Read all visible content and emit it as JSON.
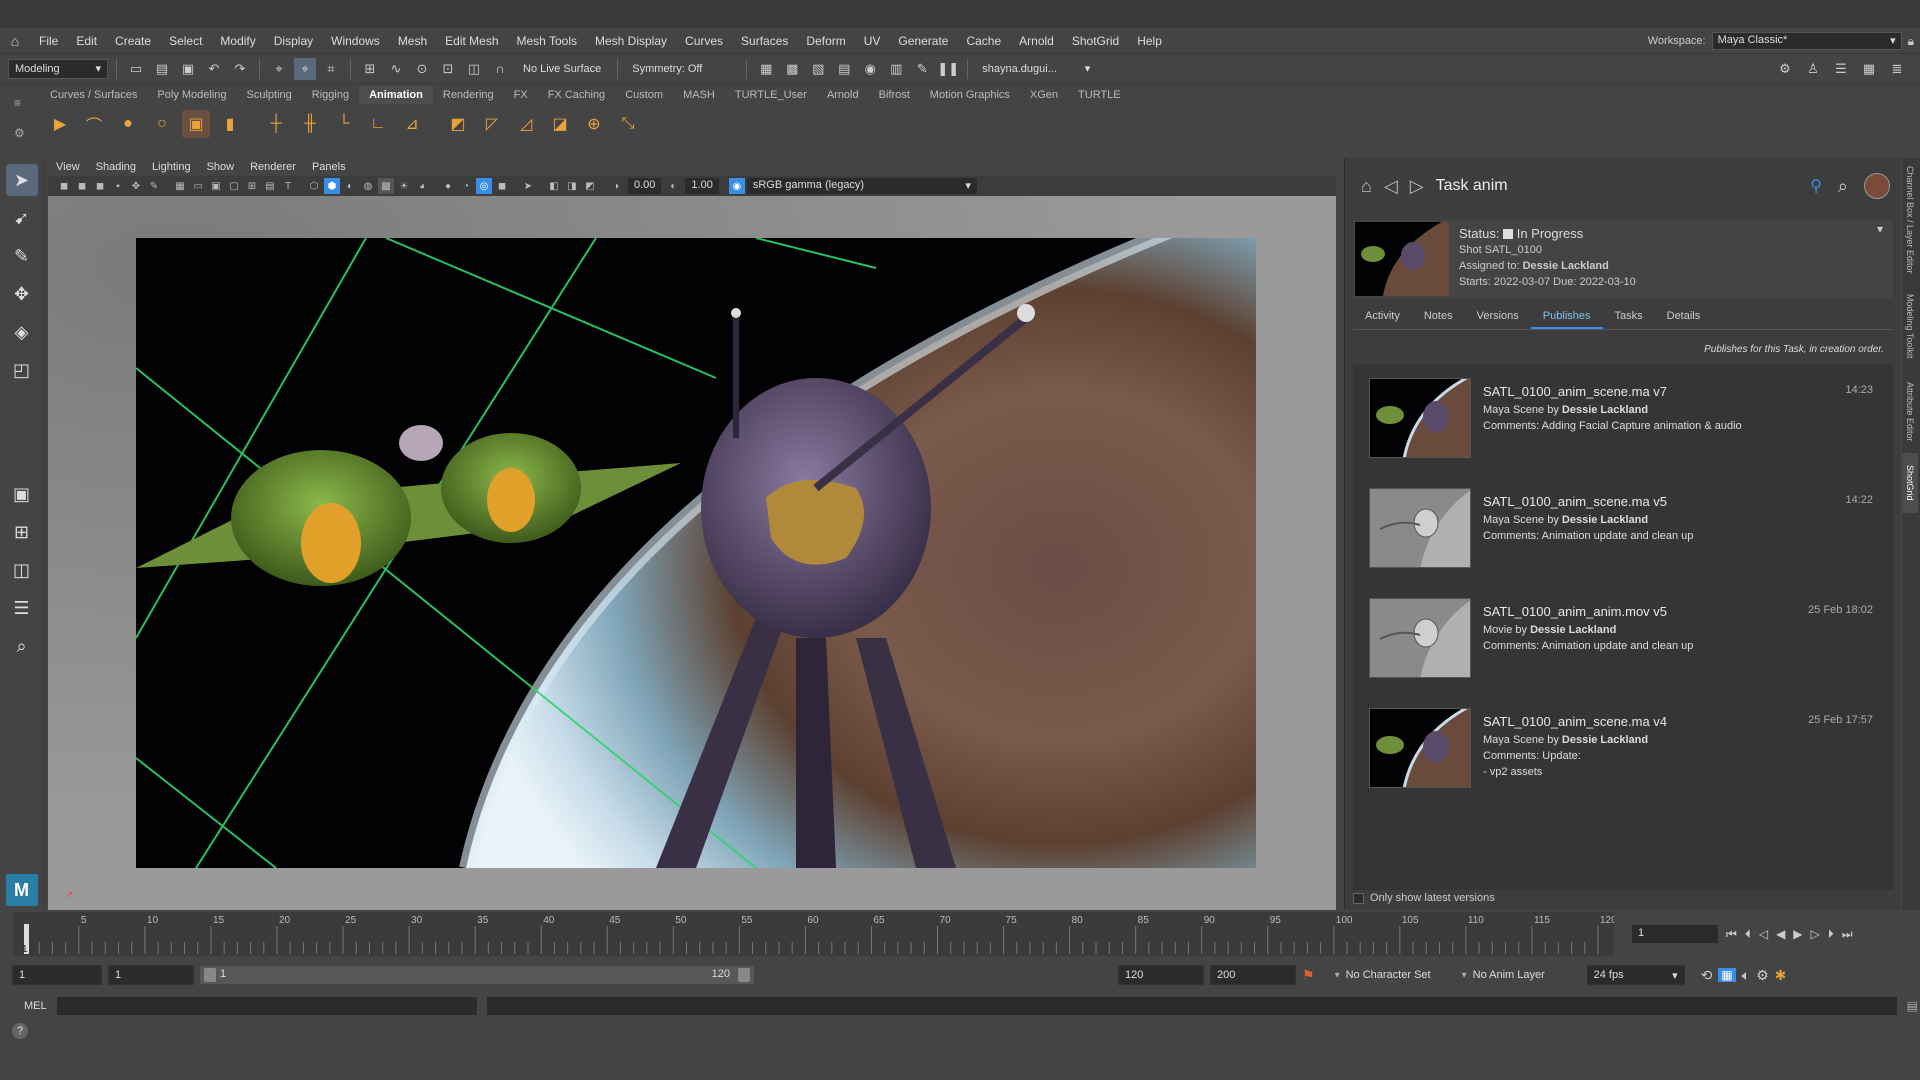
{
  "menubar": {
    "items": [
      "File",
      "Edit",
      "Create",
      "Select",
      "Modify",
      "Display",
      "Windows",
      "Mesh",
      "Edit Mesh",
      "Mesh Tools",
      "Mesh Display",
      "Curves",
      "Surfaces",
      "Deform",
      "UV",
      "Generate",
      "Cache",
      "Arnold",
      "ShotGrid",
      "Help"
    ],
    "workspace_label": "Workspace:",
    "workspace_value": "Maya Classic*"
  },
  "statusline": {
    "mode": "Modeling",
    "live_surface": "No Live Surface",
    "symmetry": "Symmetry: Off",
    "user": "shayna.dugui..."
  },
  "shelf": {
    "tabs": [
      "Curves / Surfaces",
      "Poly Modeling",
      "Sculpting",
      "Rigging",
      "Animation",
      "Rendering",
      "FX",
      "FX Caching",
      "Custom",
      "MASH",
      "TURTLE_User",
      "Arnold",
      "Bifrost",
      "Motion Graphics",
      "XGen",
      "TURTLE"
    ],
    "active_tab": "Animation"
  },
  "viewport": {
    "menu": [
      "View",
      "Shading",
      "Lighting",
      "Show",
      "Renderer",
      "Panels"
    ],
    "exposure": "0.00",
    "gamma": "1.00",
    "color_space": "sRGB gamma (legacy)"
  },
  "panel": {
    "title": "Task anim",
    "status_label": "Status:",
    "status_value": "In Progress",
    "shot": "Shot SATL_0100",
    "assigned_label": "Assigned to:",
    "assigned_value": "Dessie Lackland",
    "dates": "Starts: 2022-03-07 Due: 2022-03-10",
    "tabs": [
      "Activity",
      "Notes",
      "Versions",
      "Publishes",
      "Tasks",
      "Details"
    ],
    "active_tab": "Publishes",
    "note": "Publishes for this Task, in creation order.",
    "publishes": [
      {
        "name": "SATL_0100_anim_scene.ma v7",
        "type": "Maya Scene by",
        "author": "Dessie Lackland",
        "comments": "Comments: Adding Facial Capture animation & audio",
        "comments2": "",
        "time": "14:23",
        "thumb": "color"
      },
      {
        "name": "SATL_0100_anim_scene.ma v5",
        "type": "Maya Scene by",
        "author": "Dessie Lackland",
        "comments": "Comments: Animation update and clean up",
        "comments2": "",
        "time": "14:22",
        "thumb": "grey"
      },
      {
        "name": "SATL_0100_anim_anim.mov v5",
        "type": "Movie by",
        "author": "Dessie Lackland",
        "comments": "Comments: Animation update and clean up",
        "comments2": "",
        "time": "25 Feb 18:02",
        "thumb": "grey"
      },
      {
        "name": "SATL_0100_anim_scene.ma v4",
        "type": "Maya Scene by",
        "author": "Dessie Lackland",
        "comments": "Comments: Update:",
        "comments2": "- vp2 assets",
        "time": "25 Feb 17:57",
        "thumb": "color"
      }
    ],
    "footer": "Only show latest versions"
  },
  "timeline": {
    "ticks": [
      5,
      10,
      15,
      20,
      25,
      30,
      35,
      40,
      45,
      50,
      55,
      60,
      65,
      70,
      75,
      80,
      85,
      90,
      95,
      100,
      105,
      110,
      115,
      120
    ],
    "start_label": "1",
    "current_frame": "1"
  },
  "range": {
    "start": "1",
    "anim_start": "1",
    "slider_start": "1",
    "slider_end": "120",
    "end": "120",
    "anim_end": "200",
    "character_set": "No Character Set",
    "anim_layer": "No Anim Layer",
    "fps": "24 fps"
  },
  "command": {
    "label": "MEL"
  },
  "sidetabs": [
    "Channel Box / Layer Editor",
    "Modeling Toolkit",
    "Attribute Editor",
    "ShotGrid"
  ],
  "colors": {
    "accent": "#3a8ee6",
    "active_tab": "#7cc3f0",
    "panel_bg": "#3d3d3d"
  }
}
